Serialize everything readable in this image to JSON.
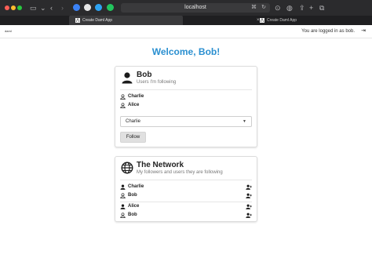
{
  "browser": {
    "url": "localhost",
    "tabs": [
      {
        "label": "Create Daml App",
        "favicon": "daml-logo-icon"
      },
      {
        "label": "Create Daml App"
      }
    ]
  },
  "header": {
    "logo": "daml",
    "logged_in": "You are logged in as bob.",
    "logout_icon": "logout-icon"
  },
  "welcome": "Welcome, Bob!",
  "following_card": {
    "title": "Bob",
    "subtitle": "Users I'm following",
    "users": [
      {
        "name": "Charlie",
        "icon": "user-outline-icon"
      },
      {
        "name": "Alice",
        "icon": "user-outline-icon"
      }
    ],
    "select": {
      "value": "Charlie"
    },
    "follow_label": "Follow"
  },
  "network_card": {
    "title": "The Network",
    "subtitle": "My followers and users they are following",
    "groups": [
      [
        {
          "name": "Charlie",
          "icon": "user-filled-icon"
        },
        {
          "name": "Bob",
          "icon": "user-outline-icon"
        }
      ],
      [
        {
          "name": "Alice",
          "icon": "user-filled-icon"
        },
        {
          "name": "Bob",
          "icon": "user-outline-icon"
        }
      ]
    ]
  },
  "colors": {
    "accent": "#2a8fd0",
    "chrome": "#2b2b2d"
  }
}
